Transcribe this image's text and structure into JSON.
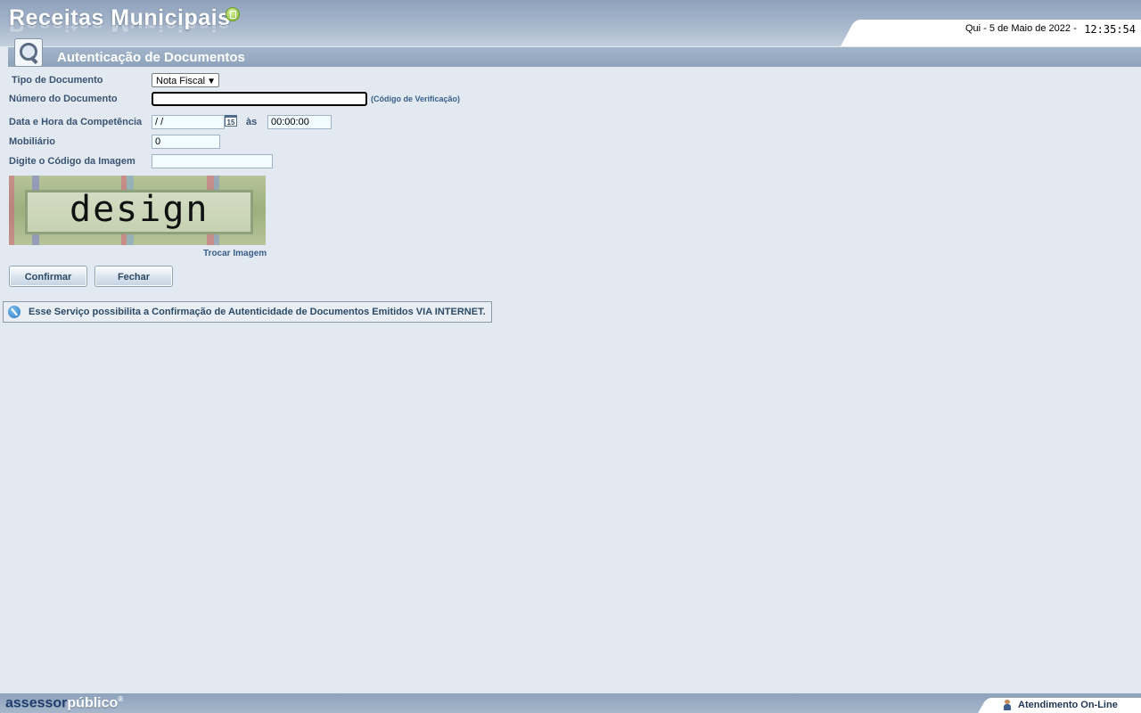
{
  "header": {
    "logo_text": "Receitas Municipais",
    "date": "Qui  -  5 de Maio de 2022  -",
    "time": "12:35:54"
  },
  "page": {
    "title": "Autenticação de Documentos"
  },
  "form": {
    "doc_type_label": "Tipo de Documento",
    "doc_type_value": "Nota Fiscal",
    "doc_number_label": "Número do Documento",
    "doc_number_value": "",
    "verification_link": "(Código de Verificação)",
    "competence_label": "Data e Hora da Competência",
    "competence_date": " /  /",
    "as_label": "às",
    "competence_time": "00:00:00",
    "calendar_text": "15",
    "mobiliario_label": "Mobiliário",
    "mobiliario_value": "0",
    "image_code_label": "Digite o Código da Imagem",
    "image_code_value": "",
    "captcha_word": "design",
    "swap_image_link": "Trocar Imagem",
    "confirm_button": "Confirmar",
    "close_button": "Fechar"
  },
  "info": {
    "message": "Esse Serviço possibilita a Confirmação de Autenticidade de Documentos Emitidos VIA INTERNET."
  },
  "footer": {
    "brand_part1": "assessor",
    "brand_part2": "público",
    "brand_mark": "®",
    "online_label": "Atendimento On-Line"
  },
  "colors": {
    "background": "#e3e9f1",
    "header": "#8ea2bc",
    "label_text": "#3a5472",
    "link": "#3a5f8a"
  }
}
